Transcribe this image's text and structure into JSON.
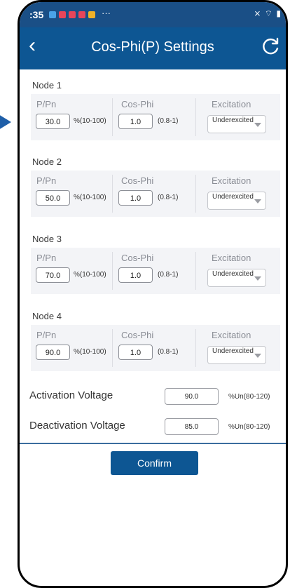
{
  "status_bar": {
    "time": ":35",
    "more": "···",
    "system_icons": "⨯ ⌔ ▮"
  },
  "header": {
    "title": "Cos-Phi(P) Settings",
    "back_icon": "chevron-left-icon",
    "refresh_icon": "refresh-icon"
  },
  "nodes": [
    {
      "title": "Node 1",
      "p_label": "P/Pn",
      "p_value": "30.0",
      "p_range": "%(10-100)",
      "cos_label": "Cos-Phi",
      "cos_value": "1.0",
      "cos_range": "(0.8-1)",
      "excitation_label": "Excitation",
      "excitation_value": "Underexcited"
    },
    {
      "title": "Node 2",
      "p_label": "P/Pn",
      "p_value": "50.0",
      "p_range": "%(10-100)",
      "cos_label": "Cos-Phi",
      "cos_value": "1.0",
      "cos_range": "(0.8-1)",
      "excitation_label": "Excitation",
      "excitation_value": "Underexcited"
    },
    {
      "title": "Node 3",
      "p_label": "P/Pn",
      "p_value": "70.0",
      "p_range": "%(10-100)",
      "cos_label": "Cos-Phi",
      "cos_value": "1.0",
      "cos_range": "(0.8-1)",
      "excitation_label": "Excitation",
      "excitation_value": "Underexcited"
    },
    {
      "title": "Node 4",
      "p_label": "P/Pn",
      "p_value": "90.0",
      "p_range": "%(10-100)",
      "cos_label": "Cos-Phi",
      "cos_value": "1.0",
      "cos_range": "(0.8-1)",
      "excitation_label": "Excitation",
      "excitation_value": "Underexcited"
    }
  ],
  "activation": {
    "label": "Activation Voltage",
    "value": "90.0",
    "range": "%Un(80-120)"
  },
  "deactivation": {
    "label": "Deactivation Voltage",
    "value": "85.0",
    "range": "%Un(80-120)"
  },
  "confirm_label": "Confirm",
  "colors": {
    "primary": "#0d5693",
    "statusbar": "#1a4f86",
    "panel": "#f3f4f7",
    "pointer": "#1f5fa8"
  }
}
